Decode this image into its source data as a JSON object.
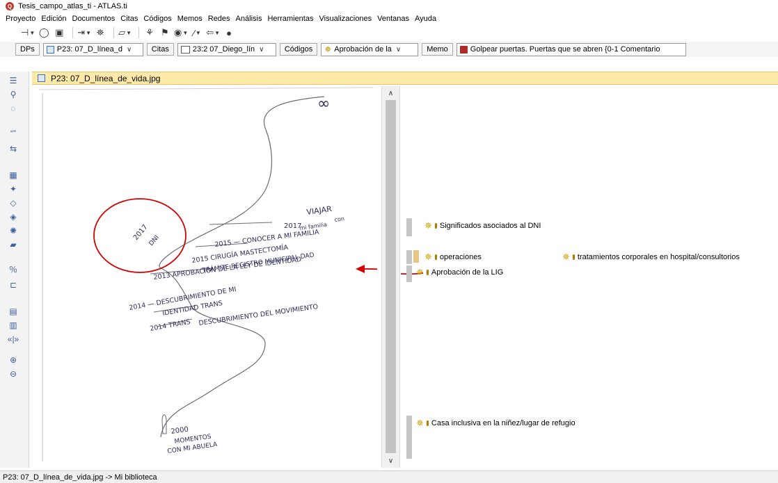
{
  "window": {
    "title": "Tesis_campo_atlas_ti - ATLAS.ti"
  },
  "menu": [
    "Proyecto",
    "Edición",
    "Documentos",
    "Citas",
    "Códigos",
    "Memos",
    "Redes",
    "Análisis",
    "Herramientas",
    "Visualizaciones",
    "Ventanas",
    "Ayuda"
  ],
  "toolbar2": {
    "dps_label": "DPs",
    "doc_combo": "P23: 07_D_línea_d",
    "citas_label": "Citas",
    "quote_combo": "23:2 07_Diego_lín",
    "codigos_label": "Códigos",
    "code_combo": "Aprobación de la",
    "memo_label": "Memo",
    "memo_combo": "Golpear puertas. Puertas que se abren {0-1 Comentario"
  },
  "document": {
    "header_title": "P23: 07_D_línea_de_vida.jpg"
  },
  "codes": [
    {
      "label": "Significados asociados al DNI"
    },
    {
      "label": "operaciones"
    },
    {
      "label": "tratamientos corporales en hospital/consultorios"
    },
    {
      "label": "Aprobación de la LIG"
    },
    {
      "label": "Casa inclusiva en la niñez/lugar de refugio"
    }
  ],
  "handwriting": {
    "infinity": "∞",
    "viajar_1": "VIAJAR",
    "viajar_2": "con",
    "viajar_3": "mi familia",
    "y2017a": "2017",
    "conocer": "2015 — CONOCER A MI FAMILIA",
    "y2017b": "2017",
    "dni": "DNI",
    "cirugia": "2015  CIRUGÍA  MASTECTOMÍA",
    "tramite": "TRÁMITE REGISTRO MUNICIPAL DAD",
    "aprobacion": "2013  APROBACIÓN DE LA LEY DE IDENTIDAD",
    "descub": "2014 — DESCUBRIMIENTO DE MI",
    "identidad": "IDENTIDAD TRANS",
    "descub_mov": "DESCUBRIMIENTO DEL MOVIMIENTO",
    "trans": "2014   TRANS",
    "y2000": "2000",
    "momentos": "MOMENTOS",
    "abuela": "CON MI ABUELA"
  },
  "status": {
    "text": "P23: 07_D_línea_de_vida.jpg ->  Mi biblioteca"
  },
  "colors": {
    "highlight_header": "#ffe9a8",
    "annotation_red": "#d40000",
    "code_star": "#c9a400"
  }
}
